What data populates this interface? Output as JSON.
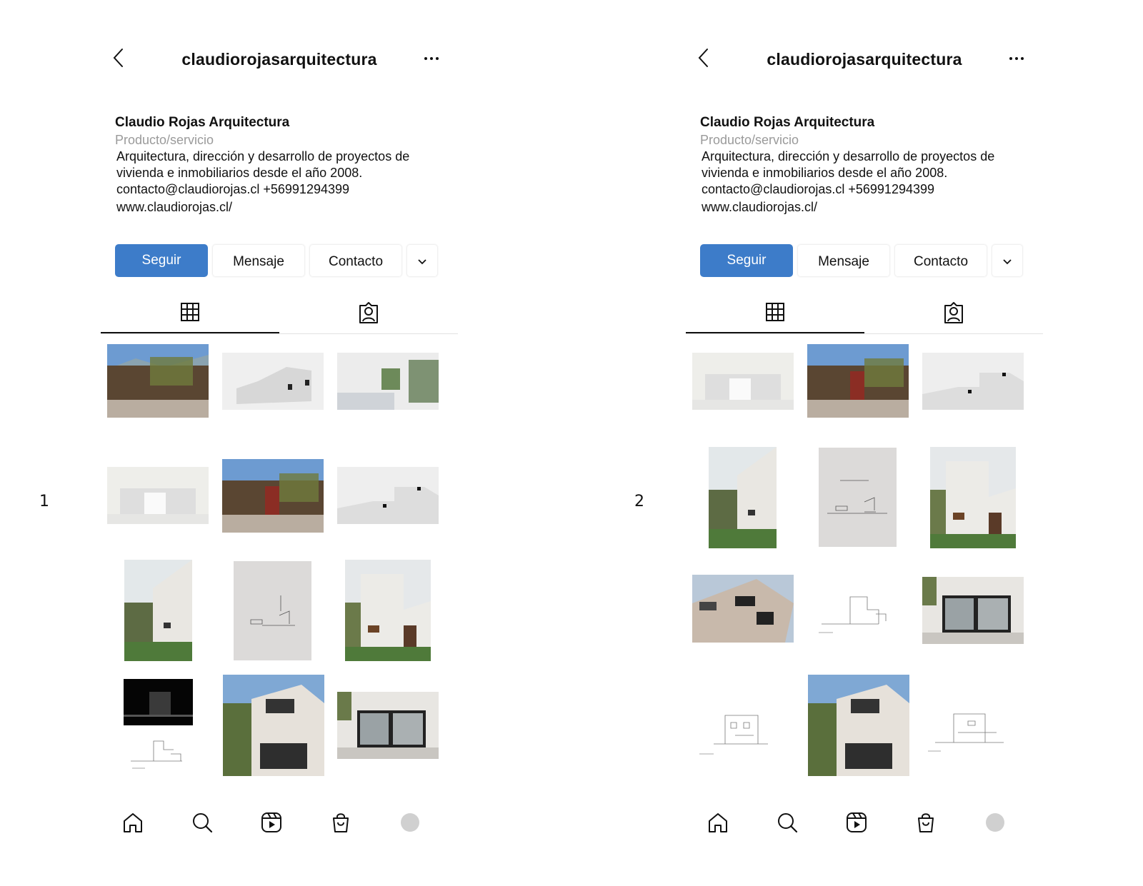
{
  "panels": [
    {
      "number": "1",
      "header": {
        "username": "claudiorojasarquitectura",
        "back_icon": "chevron-left-icon",
        "more_icon": "ellipsis-icon"
      },
      "bio": {
        "name": "Claudio Rojas Arquitectura",
        "category": "Producto/servicio",
        "description_line1": "Arquitectura, dirección y desarrollo de proyectos de",
        "description_line2": "vivienda e inmobiliarios desde el año 2008.",
        "contact": "contacto@claudiorojas.cl +56991294399",
        "website": "www.claudiorojas.cl/"
      },
      "actions": {
        "follow": "Seguir",
        "message": "Mensaje",
        "contact": "Contacto"
      },
      "tabs": {
        "grid_icon": "grid-icon",
        "tagged_icon": "tagged-person-icon"
      },
      "posts": [
        "house-wood-facade",
        "render-white-volume",
        "bedroom-interior",
        "render-white-block",
        "house-red-door",
        "render-white-slope",
        "white-wall-garden",
        "drawing-elevation",
        "white-house-windows",
        "render-night-and-drawing",
        "white-house-corner",
        "glass-patio"
      ]
    },
    {
      "number": "2",
      "header": {
        "username": "claudiorojasarquitectura",
        "back_icon": "chevron-left-icon",
        "more_icon": "ellipsis-icon"
      },
      "bio": {
        "name": "Claudio Rojas Arquitectura",
        "category": "Producto/servicio",
        "description_line1": "Arquitectura, dirección y desarrollo de proyectos de",
        "description_line2": "vivienda e inmobiliarios desde el año 2008.",
        "contact": "contacto@claudiorojas.cl +56991294399",
        "website": "www.claudiorojas.cl/"
      },
      "actions": {
        "follow": "Seguir",
        "message": "Mensaje",
        "contact": "Contacto"
      },
      "tabs": {
        "grid_icon": "grid-icon",
        "tagged_icon": "tagged-person-icon"
      },
      "posts": [
        "render-white-block",
        "house-red-door",
        "render-white-slope",
        "white-wall-garden",
        "drawing-elevation",
        "white-house-windows",
        "white-house-from-below",
        "drawing-section",
        "glass-patio",
        "drawing-facade",
        "white-house-corner",
        "drawing-side-elevation"
      ]
    }
  ],
  "bottom_nav": [
    "home-icon",
    "search-icon",
    "reels-icon",
    "shop-icon",
    "profile-avatar"
  ],
  "colors": {
    "follow_button": "#3d7cc9",
    "category_text": "#9a9a9a",
    "divider": "#e2e2e2"
  }
}
